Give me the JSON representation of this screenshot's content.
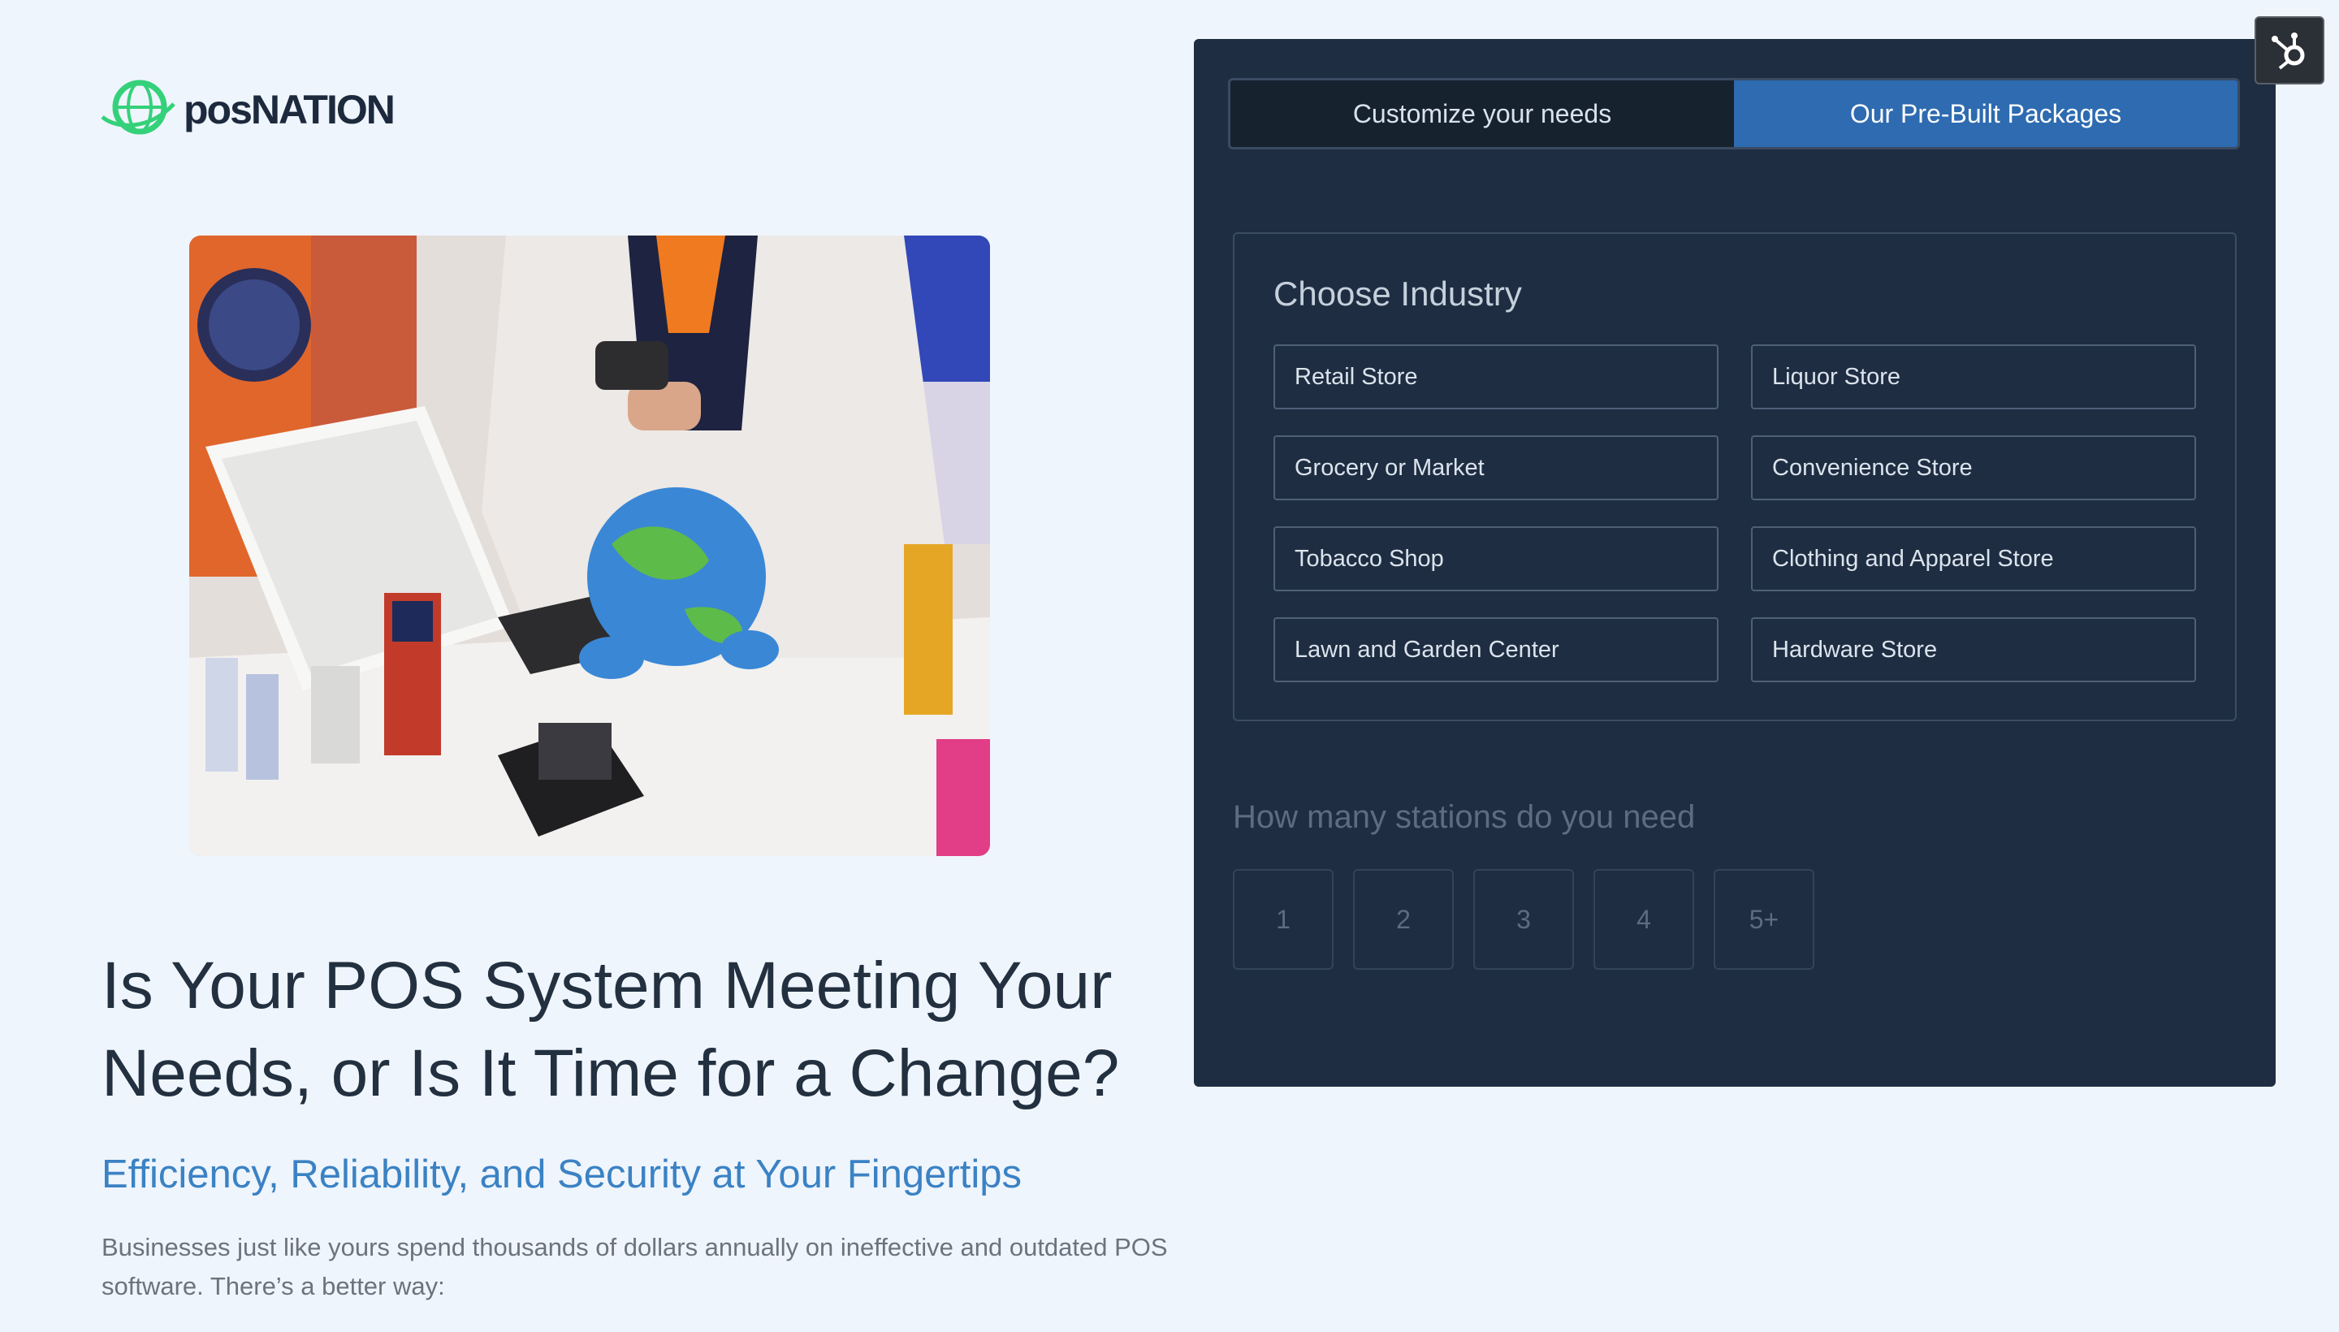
{
  "logo": {
    "text_pos": "pos",
    "text_nation": "NATION",
    "icon": "globe-logo-icon"
  },
  "hero": {
    "headline": "Is Your POS System Meeting Your Needs, or Is It Time for a Change?",
    "subheadline": "Efficiency, Reliability, and Security at Your Fingertips",
    "body": "Businesses just like yours spend thousands of dollars annually on ineffective and outdated POS software. There’s a better way:",
    "photo_icon": "cashier-photo"
  },
  "panel": {
    "tabs": [
      {
        "label": "Customize your needs",
        "active": false
      },
      {
        "label": "Our Pre-Built Packages",
        "active": true
      }
    ],
    "industry": {
      "title": "Choose Industry",
      "options": [
        "Retail Store",
        "Liquor Store",
        "Grocery or Market",
        "Convenience Store",
        "Tobacco Shop",
        "Clothing and Apparel Store",
        "Lawn and Garden Center",
        "Hardware Store"
      ]
    },
    "stations": {
      "title": "How many stations do you need",
      "options": [
        "1",
        "2",
        "3",
        "4",
        "5+"
      ]
    }
  },
  "colors": {
    "page_bg": "#eff5fd",
    "panel_bg": "#1e2d42",
    "active_tab": "#2e6bb0",
    "accent_blue": "#3b82c4",
    "logo_green": "#34d17a"
  },
  "icons": {
    "chat_badge": "hubspot-sprocket-icon"
  }
}
